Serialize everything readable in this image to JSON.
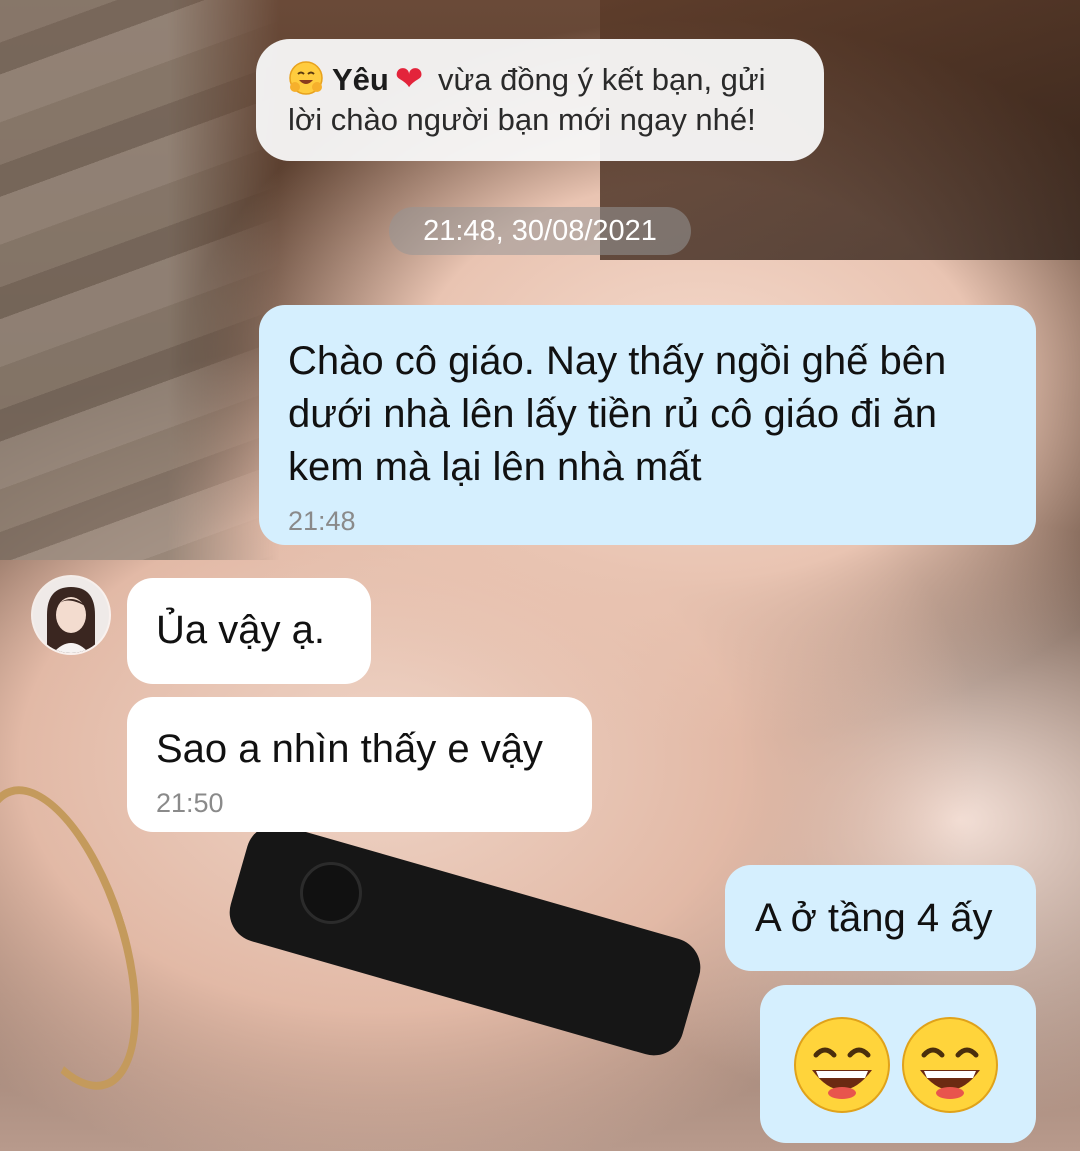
{
  "notice": {
    "emoji": "hugging-face-emoji",
    "name": "Yêu",
    "heart": "❤",
    "text": " vừa đồng ý kết bạn, gửi lời chào người bạn mới ngay nhé!"
  },
  "timestamp": "21:48, 30/08/2021",
  "messages": [
    {
      "side": "sent",
      "text": "Chào cô giáo. Nay thấy ngồi ghế bên dưới nhà lên lấy tiền rủ cô giáo đi ăn kem mà lại lên nhà mất",
      "time": "21:48"
    },
    {
      "side": "received",
      "text": "Ủa vậy ạ."
    },
    {
      "side": "received",
      "text": "Sao a nhìn thấy e vậy",
      "time": "21:50"
    },
    {
      "side": "sent",
      "text": "A ở tầng 4 ấy"
    },
    {
      "side": "sent",
      "emoji": [
        "grinning-face-emoji",
        "grinning-face-emoji"
      ]
    }
  ],
  "colors": {
    "sent_bubble": "#d5effe",
    "received_bubble": "#ffffff",
    "time_text": "#8a8a8a"
  }
}
